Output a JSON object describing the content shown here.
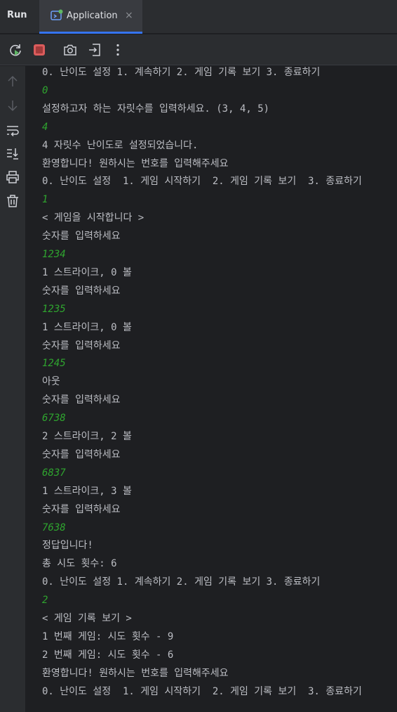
{
  "window": {
    "panel_title": "Run",
    "tab": {
      "label": "Application",
      "close_glyph": "×",
      "icon": "application-run-icon"
    }
  },
  "toolbar": {
    "buttons": [
      {
        "name": "rerun-icon"
      },
      {
        "name": "stop-icon"
      },
      {
        "name": "camera-icon"
      },
      {
        "name": "exit-icon"
      },
      {
        "name": "more-options-icon"
      }
    ]
  },
  "side_actions": [
    {
      "name": "scroll-up-icon"
    },
    {
      "name": "scroll-down-icon"
    },
    {
      "name": "soft-wrap-icon"
    },
    {
      "name": "scroll-to-end-icon"
    },
    {
      "name": "print-icon"
    },
    {
      "name": "trash-icon"
    }
  ],
  "colors": {
    "output_text": "#bcbec4",
    "user_input": "#2fa52f",
    "accent": "#3574f0",
    "stop": "#db5c5c",
    "rerun": "#5fb865"
  },
  "console": {
    "lines": [
      {
        "text": "0. 난이도 설정 1. 계속하기 2. 게임 기록 보기 3. 종료하기",
        "kind": "output"
      },
      {
        "text": "0",
        "kind": "input"
      },
      {
        "text": "설정하고자 하는 자릿수를 입력하세요. (3, 4, 5)",
        "kind": "output"
      },
      {
        "text": "4",
        "kind": "input"
      },
      {
        "text": "4 자릿수 난이도로 설정되었습니다.",
        "kind": "output"
      },
      {
        "text": "환영합니다! 원하시는 번호를 입력해주세요",
        "kind": "output"
      },
      {
        "text": "0. 난이도 설정  1. 게임 시작하기  2. 게임 기록 보기  3. 종료하기",
        "kind": "output"
      },
      {
        "text": "1",
        "kind": "input"
      },
      {
        "text": "< 게임을 시작합니다 >",
        "kind": "output"
      },
      {
        "text": "숫자를 입력하세요",
        "kind": "output"
      },
      {
        "text": "1234",
        "kind": "input"
      },
      {
        "text": "1 스트라이크, 0 볼",
        "kind": "output"
      },
      {
        "text": "숫자를 입력하세요",
        "kind": "output"
      },
      {
        "text": "1235",
        "kind": "input"
      },
      {
        "text": "1 스트라이크, 0 볼",
        "kind": "output"
      },
      {
        "text": "숫자를 입력하세요",
        "kind": "output"
      },
      {
        "text": "1245",
        "kind": "input"
      },
      {
        "text": "아웃",
        "kind": "output"
      },
      {
        "text": "숫자를 입력하세요",
        "kind": "output"
      },
      {
        "text": "6738",
        "kind": "input"
      },
      {
        "text": "2 스트라이크, 2 볼",
        "kind": "output"
      },
      {
        "text": "숫자를 입력하세요",
        "kind": "output"
      },
      {
        "text": "6837",
        "kind": "input"
      },
      {
        "text": "1 스트라이크, 3 볼",
        "kind": "output"
      },
      {
        "text": "숫자를 입력하세요",
        "kind": "output"
      },
      {
        "text": "7638",
        "kind": "input"
      },
      {
        "text": "정답입니다!",
        "kind": "output"
      },
      {
        "text": "총 시도 횟수: 6",
        "kind": "output"
      },
      {
        "text": "0. 난이도 설정 1. 계속하기 2. 게임 기록 보기 3. 종료하기",
        "kind": "output"
      },
      {
        "text": "2",
        "kind": "input"
      },
      {
        "text": "< 게임 기록 보기 >",
        "kind": "output"
      },
      {
        "text": "1 번째 게임: 시도 횟수 - 9",
        "kind": "output"
      },
      {
        "text": "2 번째 게임: 시도 횟수 - 6",
        "kind": "output"
      },
      {
        "text": "환영합니다! 원하시는 번호를 입력해주세요",
        "kind": "output"
      },
      {
        "text": "0. 난이도 설정  1. 게임 시작하기  2. 게임 기록 보기  3. 종료하기",
        "kind": "output"
      }
    ]
  }
}
